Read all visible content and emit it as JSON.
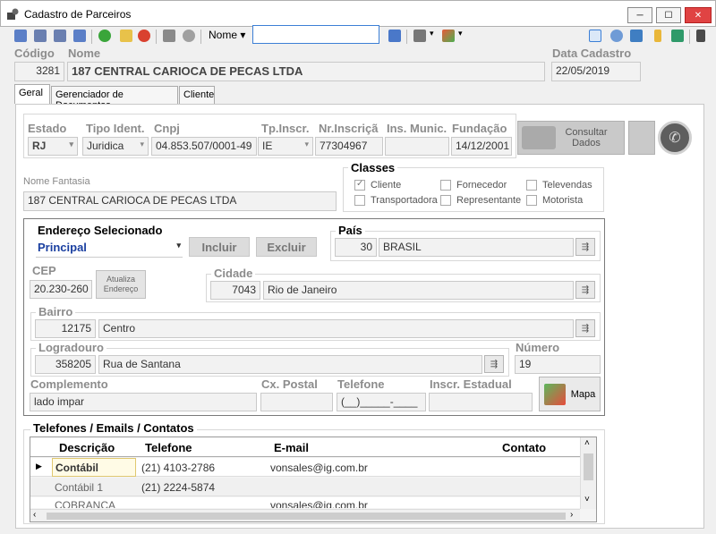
{
  "window": {
    "title": "Cadastro de Parceiros",
    "min": "─",
    "max": "☐",
    "close": "✕"
  },
  "toolbar": {
    "search_field_label": "Nome",
    "search_value": ""
  },
  "header": {
    "codigo_label": "Código",
    "codigo": "3281",
    "nome_label": "Nome",
    "nome": "187 CENTRAL CARIOCA DE PECAS LTDA",
    "data_label": "Data Cadastro",
    "data": "22/05/2019"
  },
  "tabs": [
    "Geral",
    "Gerenciador de Documentos",
    "Cliente"
  ],
  "geral": {
    "estado_label": "Estado",
    "estado": "RJ",
    "tipo_label": "Tipo Ident.",
    "tipo": "Juridica",
    "cnpj_label": "Cnpj",
    "cnpj": "04.853.507/0001-49",
    "tpinscr_label": "Tp.Inscr.",
    "tpinscr": "IE",
    "nrinscr_label": "Nr.Inscriçã",
    "nrinscr": "77304967",
    "insmunic_label": "Ins. Munic.",
    "insmunic": "",
    "fundacao_label": "Fundação",
    "fundacao": "14/12/2001",
    "consultar_label": "Consultar Dados",
    "fantasia_label": "Nome Fantasia",
    "fantasia": "187 CENTRAL CARIOCA DE PECAS LTDA",
    "classes_label": "Classes",
    "classes": [
      {
        "label": "Cliente",
        "checked": true
      },
      {
        "label": "Fornecedor",
        "checked": false
      },
      {
        "label": "Televendas",
        "checked": false
      },
      {
        "label": "Transportadora",
        "checked": false
      },
      {
        "label": "Representante",
        "checked": false
      },
      {
        "label": "Motorista",
        "checked": false
      }
    ]
  },
  "endereco": {
    "sel_label": "Endereço Selecionado",
    "sel_value": "Principal",
    "incluir": "Incluir",
    "excluir": "Excluir",
    "pais_label": "País",
    "pais_cod": "30",
    "pais": "BRASIL",
    "cep_label": "CEP",
    "cep": "20.230-260",
    "atualiza": "Atualiza Endereço",
    "cidade_label": "Cidade",
    "cidade_cod": "7043",
    "cidade": "Rio de Janeiro",
    "bairro_label": "Bairro",
    "bairro_cod": "12175",
    "bairro": "Centro",
    "logradouro_label": "Logradouro",
    "logradouro_cod": "358205",
    "logradouro": "Rua de Santana",
    "numero_label": "Número",
    "numero": "19",
    "complemento_label": "Complemento",
    "complemento": "lado impar",
    "cxpostal_label": "Cx. Postal",
    "cxpostal": "",
    "telefone_label": "Telefone",
    "telefone": "(__)_____-____",
    "inscrest_label": "Inscr. Estadual",
    "inscrest": "",
    "mapa": "Mapa"
  },
  "contatos": {
    "title": "Telefones / Emails / Contatos",
    "columns": [
      "Descrição",
      "Telefone",
      "E-mail",
      "Contato"
    ],
    "rows": [
      {
        "descricao": "Contábil",
        "telefone": "(21) 4103-2786",
        "email": "vonsales@ig.com.br",
        "contato": ""
      },
      {
        "descricao": "Contábil 1",
        "telefone": "(21) 2224-5874",
        "email": "",
        "contato": ""
      },
      {
        "descricao": "COBRANCA",
        "telefone": "",
        "email": "vonsales@ig.com.br",
        "contato": ""
      }
    ]
  },
  "colors": {
    "accent": "#1a3fa0",
    "close": "#e04343"
  }
}
